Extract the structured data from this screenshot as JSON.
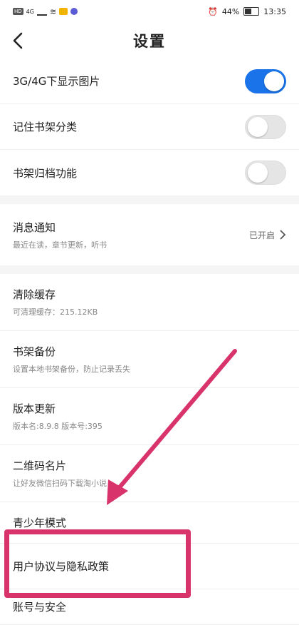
{
  "status_bar": {
    "network_badge": "HD",
    "signal": "4G",
    "battery": "44%",
    "time": "13:35"
  },
  "header": {
    "title": "设置"
  },
  "toggles": [
    {
      "label": "3G/4G下显示图片",
      "state": "on"
    },
    {
      "label": "记住书架分类",
      "state": "off"
    },
    {
      "label": "书架归档功能",
      "state": "off"
    }
  ],
  "notification": {
    "label": "消息通知",
    "sub": "最近在读，章节更新，听书",
    "value": "已开启"
  },
  "items": [
    {
      "label": "清除缓存",
      "sub": "可清理缓存：215.12KB"
    },
    {
      "label": "书架备份",
      "sub": "设置本地书架备份，防止记录丢失"
    },
    {
      "label": "版本更新",
      "sub": "版本名:8.9.8   版本号:395"
    },
    {
      "label": "二维码名片",
      "sub": "让好友微信扫码下载淘小说"
    },
    {
      "label": "青少年模式"
    },
    {
      "label": "用户协议与隐私政策"
    },
    {
      "label": "账号与安全"
    }
  ],
  "colors": {
    "accent": "#1a73e8",
    "annotation": "#d8336b"
  }
}
